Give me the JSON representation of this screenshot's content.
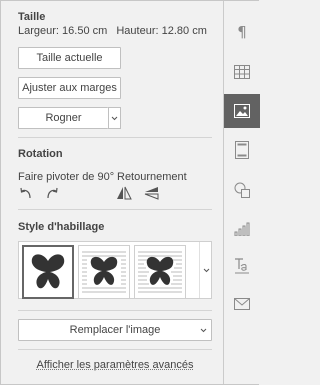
{
  "size": {
    "title": "Taille",
    "width_label": "Largeur:",
    "width_value": "16.50 cm",
    "height_label": "Hauteur:",
    "height_value": "12.80 cm",
    "actual_size_label": "Taille actuelle",
    "fit_margins_label": "Ajuster aux marges",
    "crop_label": "Rogner"
  },
  "rotation": {
    "title": "Rotation",
    "rotate_label": "Faire pivoter de 90°",
    "flip_label": "Retournement"
  },
  "wrapping": {
    "title": "Style d'habillage",
    "styles": [
      "inline",
      "square",
      "tight"
    ]
  },
  "replace_image_label": "Remplacer l'image",
  "advanced_link": "Afficher les paramètres avancés",
  "rail": {
    "items": [
      "paragraph-icon",
      "table-icon",
      "image-icon",
      "header-footer-icon",
      "shape-icon",
      "chart-icon",
      "text-art-icon",
      "mail-merge-icon"
    ],
    "active_index": 2
  }
}
